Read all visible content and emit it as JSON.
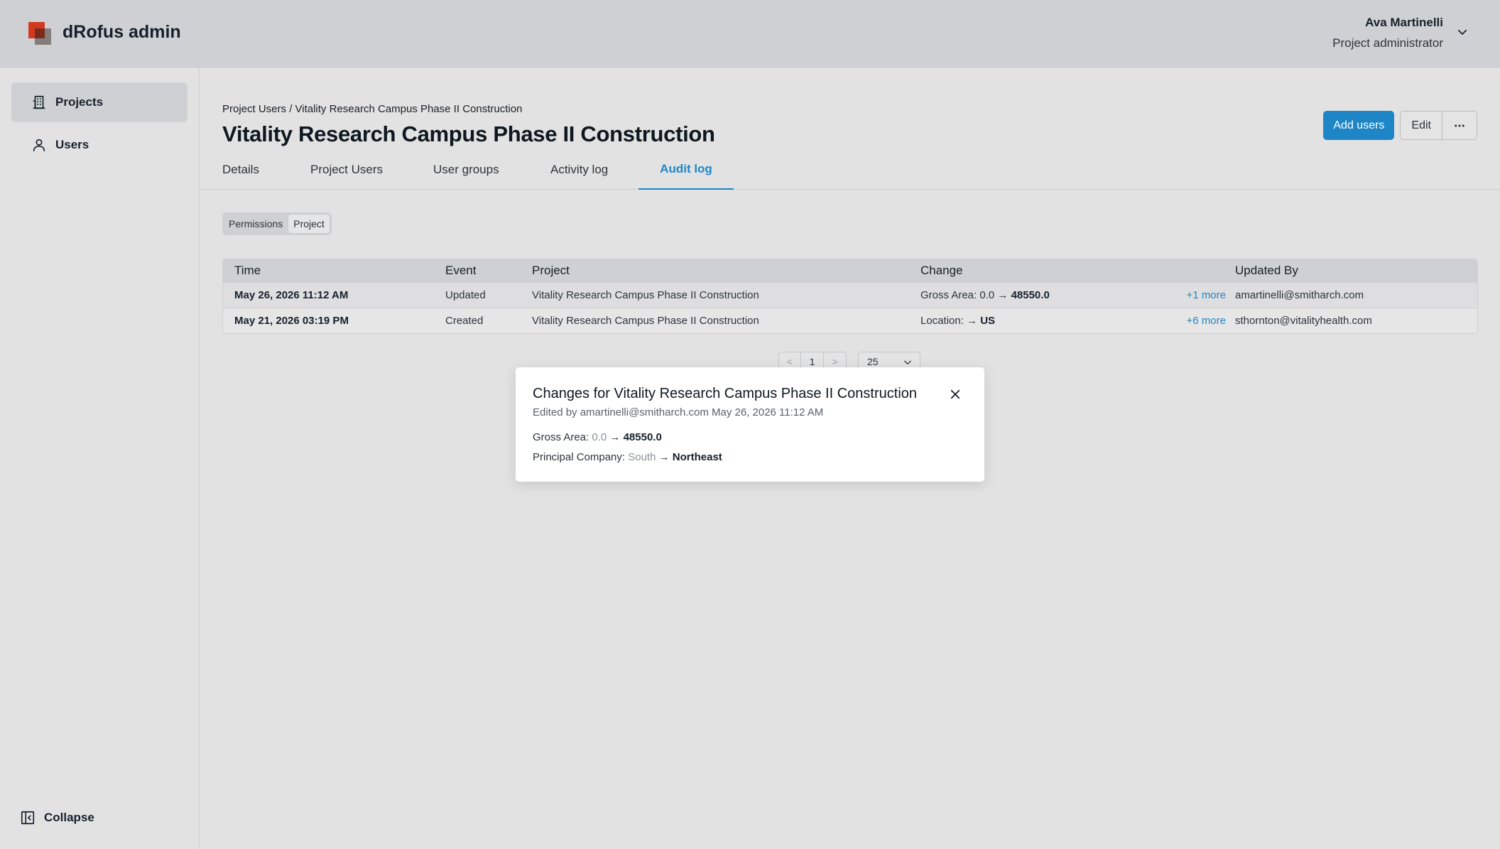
{
  "app": {
    "brand": "dRofus admin",
    "accent_color": "#1e86c6",
    "logo_colors": [
      "#d2391f",
      "#7a2a1c"
    ]
  },
  "user": {
    "name": "Ava Martinelli",
    "role": "Project administrator"
  },
  "sidebar": {
    "items": [
      {
        "label": "Projects",
        "icon": "building-icon",
        "active": true
      },
      {
        "label": "Users",
        "icon": "user-icon",
        "active": false
      }
    ],
    "collapse_label": "Collapse"
  },
  "page": {
    "breadcrumb": "Project Users / Vitality Research Campus Phase II Construction",
    "title": "Vitality Research Campus Phase II Construction",
    "actions": {
      "add_users": "Add users",
      "edit": "Edit"
    },
    "tabs": [
      {
        "label": "Details",
        "active": false
      },
      {
        "label": "Project Users",
        "active": false
      },
      {
        "label": "User groups",
        "active": false
      },
      {
        "label": "Activity log",
        "active": false
      },
      {
        "label": "Audit log",
        "active": true
      }
    ],
    "segments": [
      {
        "label": "Permissions",
        "active": false
      },
      {
        "label": "Project",
        "active": true
      }
    ]
  },
  "table": {
    "columns": [
      "Time",
      "Event",
      "Project",
      "Change",
      "Updated By"
    ],
    "rows": [
      {
        "time": "May 26, 2026 11:12 AM",
        "event": "Updated",
        "project": "Vitality Research Campus Phase II Construction",
        "change_prefix": "Gross Area: 0.0 →",
        "change_value": "48550.0",
        "more": "+1 more",
        "updated_by": "amartinelli@smitharch.com"
      },
      {
        "time": "May 21, 2026 03:19 PM",
        "event": "Created",
        "project": "Vitality Research Campus Phase II Construction",
        "change_prefix": "Location: →",
        "change_value": "US",
        "more": "+6 more",
        "updated_by": "sthornton@vitalityhealth.com"
      }
    ]
  },
  "pagination": {
    "prev": "<",
    "page": "1",
    "next": ">",
    "page_size": "25"
  },
  "dialog": {
    "title": "Changes for Vitality Research Campus Phase II Construction",
    "subtitle": "Edited by amartinelli@smitharch.com May 26, 2026 11:12 AM",
    "changes": [
      {
        "field": "Gross Area:",
        "old": "0.0",
        "new": "48550.0"
      },
      {
        "field": "Principal Company:",
        "old": "South",
        "new": "Northeast"
      }
    ]
  }
}
